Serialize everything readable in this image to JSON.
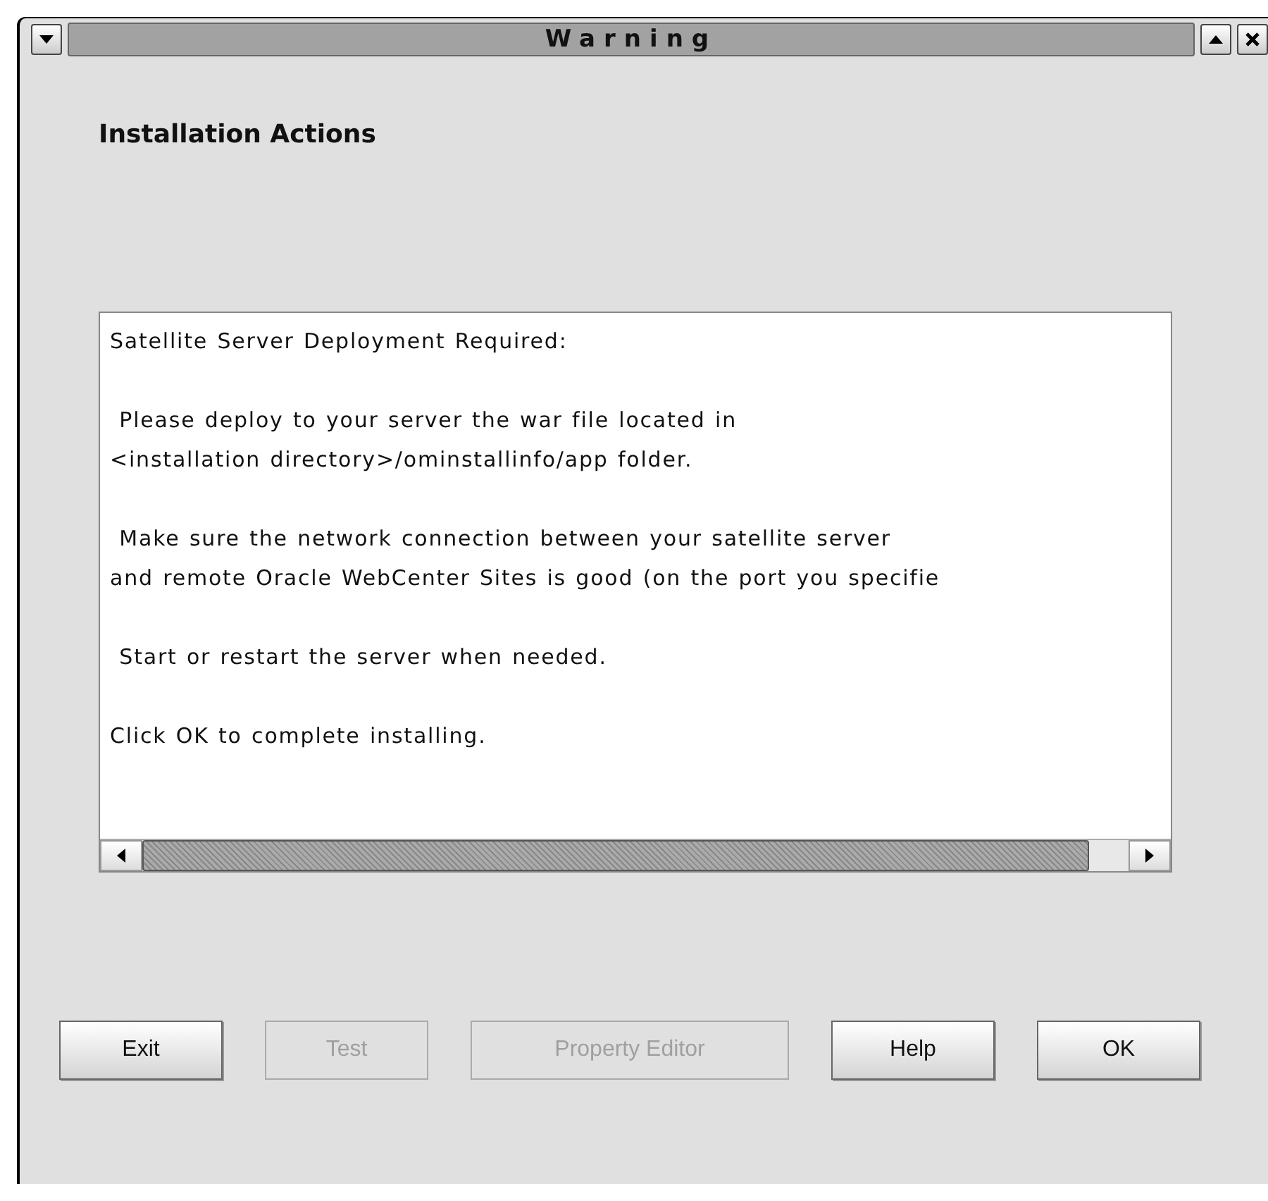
{
  "window": {
    "title": "Warning"
  },
  "heading": "Installation Actions",
  "message": {
    "paragraphs": [
      {
        "lines": [
          "Satellite Server Deployment Required:"
        ]
      },
      {
        "lines": [
          " Please deploy to your server the war file located in",
          "<installation directory>/ominstallinfo/app folder."
        ]
      },
      {
        "lines": [
          " Make sure the network connection between your satellite server",
          "and remote Oracle WebCenter Sites is good (on the port you specifie"
        ]
      },
      {
        "lines": [
          " Start or restart the server when needed."
        ]
      },
      {
        "lines": [
          "Click OK to complete installing."
        ]
      }
    ]
  },
  "buttons": [
    {
      "label": "Exit",
      "disabled": false
    },
    {
      "label": "Test",
      "disabled": true
    },
    {
      "label": "Property Editor",
      "disabled": true
    },
    {
      "label": "Help",
      "disabled": false
    },
    {
      "label": "OK",
      "disabled": false
    }
  ]
}
